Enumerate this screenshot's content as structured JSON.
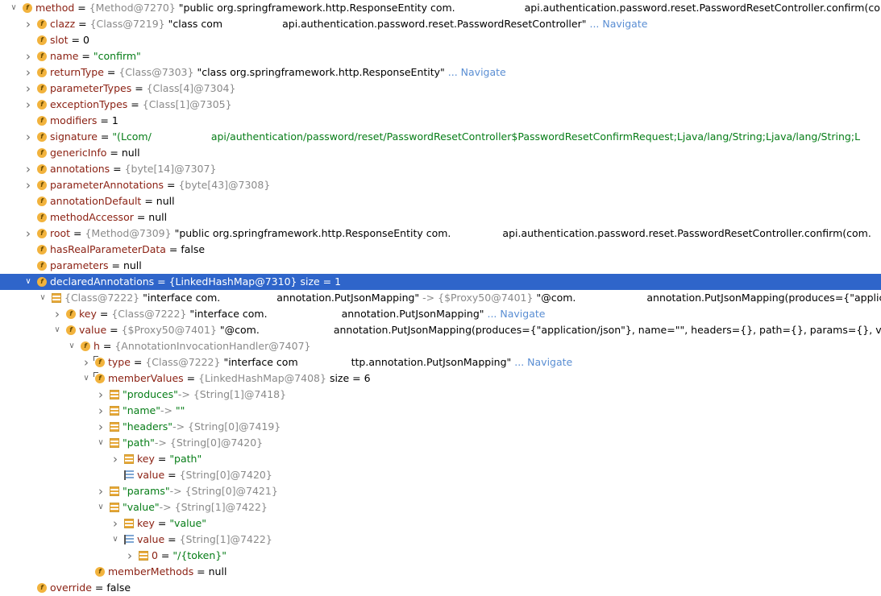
{
  "rows": [
    {
      "indent": 0,
      "caret": "expanded",
      "icon": "field",
      "name": "method",
      "ref": "{Method@7270}",
      "val": "\"public org.springframework.http.ResponseEntity com.",
      "redact": 86,
      "val2": "api.authentication.password.reset.PasswordResetController.confirm(com"
    },
    {
      "indent": 1,
      "caret": "collapsed",
      "icon": "field",
      "name": "clazz",
      "ref": "{Class@7219}",
      "val": "\"class com",
      "redact": 74,
      "val2": "api.authentication.password.reset.PasswordResetController\"",
      "nav": "... Navigate"
    },
    {
      "indent": 1,
      "caret": "none",
      "icon": "field",
      "name": "slot",
      "val": "0"
    },
    {
      "indent": 1,
      "caret": "collapsed",
      "icon": "field",
      "name": "name",
      "str": "\"confirm\""
    },
    {
      "indent": 1,
      "caret": "collapsed",
      "icon": "field",
      "name": "returnType",
      "ref": "{Class@7303}",
      "val": "\"class org.springframework.http.ResponseEntity\"",
      "nav": "... Navigate"
    },
    {
      "indent": 1,
      "caret": "collapsed",
      "icon": "field",
      "name": "parameterTypes",
      "ref": "{Class[4]@7304}"
    },
    {
      "indent": 1,
      "caret": "collapsed",
      "icon": "field",
      "name": "exceptionTypes",
      "ref": "{Class[1]@7305}"
    },
    {
      "indent": 1,
      "caret": "none",
      "icon": "field",
      "name": "modifiers",
      "val": "1"
    },
    {
      "indent": 1,
      "caret": "collapsed",
      "icon": "field",
      "name": "signature",
      "str": "\"(Lcom/",
      "redact": 74,
      "str2": "api/authentication/password/reset/PasswordResetController$PasswordResetConfirmRequest;Ljava/lang/String;Ljava/lang/String;L"
    },
    {
      "indent": 1,
      "caret": "none",
      "icon": "field",
      "name": "genericInfo",
      "val": "null"
    },
    {
      "indent": 1,
      "caret": "collapsed",
      "icon": "field",
      "name": "annotations",
      "ref": "{byte[14]@7307}"
    },
    {
      "indent": 1,
      "caret": "collapsed",
      "icon": "field",
      "name": "parameterAnnotations",
      "ref": "{byte[43]@7308}"
    },
    {
      "indent": 1,
      "caret": "none",
      "icon": "field",
      "name": "annotationDefault",
      "val": "null"
    },
    {
      "indent": 1,
      "caret": "none",
      "icon": "field",
      "name": "methodAccessor",
      "val": "null"
    },
    {
      "indent": 1,
      "caret": "collapsed",
      "icon": "field",
      "name": "root",
      "ref": "{Method@7309}",
      "val": "\"public org.springframework.http.ResponseEntity com.",
      "redact": 64,
      "val2": "api.authentication.password.reset.PasswordResetController.confirm(com."
    },
    {
      "indent": 1,
      "caret": "none",
      "icon": "field",
      "name": "hasRealParameterData",
      "val": "false"
    },
    {
      "indent": 1,
      "caret": "none",
      "icon": "field",
      "name": "parameters",
      "val": "null"
    },
    {
      "indent": 1,
      "caret": "expanded",
      "icon": "field",
      "name": "declaredAnnotations",
      "ref": "{LinkedHashMap@7310}",
      "size": "size = 1",
      "selected": true
    },
    {
      "indent": 2,
      "caret": "expanded",
      "icon": "entry",
      "ref": "{Class@7222}",
      "val": "\"interface com.",
      "redact": 70,
      "val2": "annotation.PutJsonMapping\"",
      "arrow": "->",
      "ref2": "{$Proxy50@7401}",
      "val3": "\"@com.",
      "redact2": 88,
      "val4": "annotation.PutJsonMapping(produces={\"application/j"
    },
    {
      "indent": 3,
      "caret": "collapsed",
      "icon": "field",
      "name": "key",
      "ref": "{Class@7222}",
      "val": "\"interface com.",
      "redact": 92,
      "val2": "annotation.PutJsonMapping\"",
      "nav": "... Navigate"
    },
    {
      "indent": 3,
      "caret": "expanded",
      "icon": "field",
      "name": "value",
      "ref": "{$Proxy50@7401}",
      "val": "\"@com.",
      "redact": 92,
      "val2": "annotation.PutJsonMapping(produces={\"application/json\"}, name=\"\", headers={}, path={}, params={}, value={\"/{token}\"})\""
    },
    {
      "indent": 4,
      "caret": "expanded",
      "icon": "field",
      "name": "h",
      "ref": "{AnnotationInvocationHandler@7407}"
    },
    {
      "indent": 5,
      "caret": "collapsed",
      "icon": "fieldproxy",
      "name": "type",
      "ref": "{Class@7222}",
      "val": "\"interface com",
      "redact": 66,
      "val2": "ttp.annotation.PutJsonMapping\"",
      "nav": "... Navigate"
    },
    {
      "indent": 5,
      "caret": "expanded",
      "icon": "fieldproxy",
      "name": "memberValues",
      "ref": "{LinkedHashMap@7408}",
      "size": "size = 6"
    },
    {
      "indent": 6,
      "caret": "collapsed",
      "icon": "entry",
      "str": "\"produces\"",
      "arrow": "->",
      "ref": "{String[1]@7418}"
    },
    {
      "indent": 6,
      "caret": "collapsed",
      "icon": "entry",
      "str": "\"name\"",
      "arrow": "->",
      "str2": "\"\""
    },
    {
      "indent": 6,
      "caret": "collapsed",
      "icon": "entry",
      "str": "\"headers\"",
      "arrow": "->",
      "ref": "{String[0]@7419}"
    },
    {
      "indent": 6,
      "caret": "expanded",
      "icon": "entry",
      "str": "\"path\"",
      "arrow": "->",
      "ref": "{String[0]@7420}"
    },
    {
      "indent": 7,
      "caret": "collapsed",
      "icon": "entry",
      "name": "key",
      "str": "\"path\""
    },
    {
      "indent": 7,
      "caret": "none",
      "icon": "arr",
      "name": "value",
      "ref": "{String[0]@7420}"
    },
    {
      "indent": 6,
      "caret": "collapsed",
      "icon": "entry",
      "str": "\"params\"",
      "arrow": "->",
      "ref": "{String[0]@7421}"
    },
    {
      "indent": 6,
      "caret": "expanded",
      "icon": "entry",
      "str": "\"value\"",
      "arrow": "->",
      "ref": "{String[1]@7422}"
    },
    {
      "indent": 7,
      "caret": "collapsed",
      "icon": "entry",
      "name": "key",
      "str": "\"value\""
    },
    {
      "indent": 7,
      "caret": "expanded",
      "icon": "arr",
      "name": "value",
      "ref": "{String[1]@7422}"
    },
    {
      "indent": 8,
      "caret": "collapsed",
      "icon": "entry",
      "name": "0",
      "str": "\"/{token}\""
    },
    {
      "indent": 5,
      "caret": "none",
      "icon": "field",
      "name": "memberMethods",
      "val": "null"
    },
    {
      "indent": 1,
      "caret": "none",
      "icon": "field",
      "name": "override",
      "val": "false"
    }
  ]
}
